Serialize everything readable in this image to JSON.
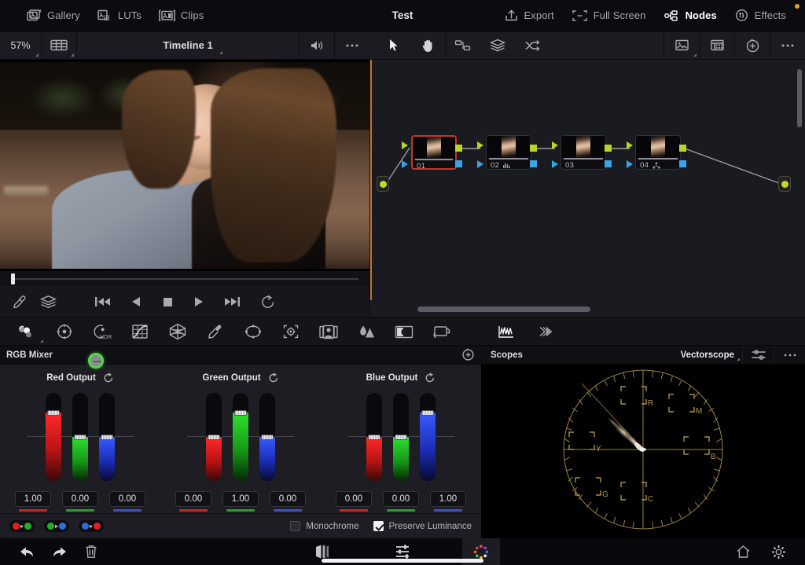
{
  "topbar": {
    "left_items": [
      {
        "label": "Gallery",
        "icon": "gallery-icon"
      },
      {
        "label": "LUTs",
        "icon": "luts-icon"
      },
      {
        "label": "Clips",
        "icon": "clips-icon"
      }
    ],
    "title": "Test",
    "right_items": [
      {
        "label": "Export",
        "icon": "export-icon",
        "active": false
      },
      {
        "label": "Full Screen",
        "icon": "fullscreen-icon",
        "active": false
      },
      {
        "label": "Nodes",
        "icon": "nodes-icon",
        "active": true
      },
      {
        "label": "Effects",
        "icon": "effects-icon",
        "active": false,
        "badge": true
      }
    ]
  },
  "toolbar": {
    "zoom": "57%",
    "viewer_mode_icon": "grid-view-icon",
    "timeline_name": "Timeline 1",
    "audio_icon": "speaker-icon",
    "more_icon": "more-options-icon",
    "node_tools": [
      {
        "icon": "pointer-tool-icon",
        "active": true
      },
      {
        "icon": "hand-tool-icon",
        "active": false
      },
      {
        "icon": "node-connect-icon",
        "active": false
      },
      {
        "icon": "layer-nodes-icon",
        "active": false
      },
      {
        "icon": "shuffle-nodes-icon",
        "active": false
      }
    ],
    "right_tools": [
      {
        "icon": "thumbnail-view-icon"
      },
      {
        "icon": "node-grid-icon"
      },
      {
        "icon": "reset-history-icon"
      },
      {
        "icon": "more-options-icon"
      }
    ]
  },
  "viewer": {
    "playhead_position": "0%",
    "tools": [
      {
        "icon": "eyedropper-icon"
      },
      {
        "icon": "layers-icon"
      }
    ],
    "transport": [
      {
        "icon": "previous-clip-icon"
      },
      {
        "icon": "play-reverse-icon"
      },
      {
        "icon": "stop-icon"
      },
      {
        "icon": "play-icon"
      },
      {
        "icon": "next-clip-icon"
      },
      {
        "icon": "loop-icon"
      }
    ]
  },
  "node_graph": {
    "nodes": [
      {
        "label": "01",
        "selected": true,
        "badge": null
      },
      {
        "label": "02",
        "selected": false,
        "badge": "histogram-icon"
      },
      {
        "label": "03",
        "selected": false,
        "badge": null
      },
      {
        "label": "04",
        "selected": false,
        "badge": "node-tree-icon"
      }
    ],
    "source_node": "source-port",
    "output_node": "output-port"
  },
  "palette_toolbar": {
    "left_tools": [
      {
        "icon": "color-wheels-icon",
        "active": true
      },
      {
        "icon": "primaries-bars-icon",
        "active": false
      },
      {
        "icon": "hdr-wheels-icon",
        "active": false
      },
      {
        "icon": "curves-icon",
        "active": false
      },
      {
        "icon": "color-warper-icon",
        "active": false
      },
      {
        "icon": "qualifier-icon",
        "active": false
      },
      {
        "icon": "power-window-icon",
        "active": false
      },
      {
        "icon": "tracker-icon",
        "active": false
      },
      {
        "icon": "magic-mask-icon",
        "active": false
      },
      {
        "icon": "blur-icon",
        "active": false
      },
      {
        "icon": "key-icon",
        "active": false
      },
      {
        "icon": "sizing-icon",
        "active": false
      }
    ],
    "right_tools": [
      {
        "icon": "scopes-icon",
        "active": true
      },
      {
        "icon": "gallery-stills-icon",
        "active": false
      }
    ]
  },
  "rgb_mixer": {
    "title": "RGB Mixer",
    "reset_icon": "reset-icon",
    "groups": [
      {
        "label": "Red Output",
        "reset_icon": "reset-icon",
        "channels": [
          {
            "name": "red",
            "value": "1.00",
            "color": "#d62121",
            "knob_pct": 78
          },
          {
            "name": "green",
            "value": "0.00",
            "color": "#2a9f2a",
            "knob_pct": 50
          },
          {
            "name": "blue",
            "value": "0.00",
            "color": "#3a54c8",
            "knob_pct": 50
          }
        ]
      },
      {
        "label": "Green Output",
        "reset_icon": "reset-icon",
        "channels": [
          {
            "name": "red",
            "value": "0.00",
            "color": "#d62121",
            "knob_pct": 50
          },
          {
            "name": "green",
            "value": "1.00",
            "color": "#2a9f2a",
            "knob_pct": 78
          },
          {
            "name": "blue",
            "value": "0.00",
            "color": "#3a54c8",
            "knob_pct": 50
          }
        ]
      },
      {
        "label": "Blue Output",
        "reset_icon": "reset-icon",
        "channels": [
          {
            "name": "red",
            "value": "0.00",
            "color": "#d62121",
            "knob_pct": 50
          },
          {
            "name": "green",
            "value": "0.00",
            "color": "#2a9f2a",
            "knob_pct": 50
          },
          {
            "name": "blue",
            "value": "1.00",
            "color": "#3a54c8",
            "knob_pct": 78
          }
        ]
      }
    ],
    "swap_buttons": [
      {
        "name": "swap-red-green",
        "from": "#e02020",
        "to": "#20b020"
      },
      {
        "name": "swap-green-blue",
        "from": "#20b020",
        "to": "#2a6de0"
      },
      {
        "name": "swap-blue-red",
        "from": "#2a6de0",
        "to": "#e02020"
      }
    ],
    "monochrome_label": "Monochrome",
    "monochrome_checked": false,
    "preserve_luminance_label": "Preserve Luminance",
    "preserve_luminance_checked": true
  },
  "scopes": {
    "title": "Scopes",
    "selected": "Vectorscope",
    "settings_icon": "scope-settings-icon",
    "more_icon": "more-options-icon",
    "vectorscope": {
      "targets": [
        "R",
        "M",
        "B",
        "C",
        "G",
        "Y"
      ],
      "graticule_color": "#9a8240",
      "trace_color": "#d8c4ae"
    }
  },
  "statusbar": {
    "left": [
      {
        "icon": "undo-icon"
      },
      {
        "icon": "redo-icon"
      },
      {
        "icon": "delete-icon"
      }
    ],
    "pages": [
      {
        "icon": "cut-page-icon",
        "active": false
      },
      {
        "icon": "fairlight-page-icon",
        "active": false
      },
      {
        "icon": "color-page-icon",
        "active": true
      }
    ],
    "right": [
      {
        "icon": "home-icon"
      },
      {
        "icon": "settings-icon"
      }
    ]
  }
}
